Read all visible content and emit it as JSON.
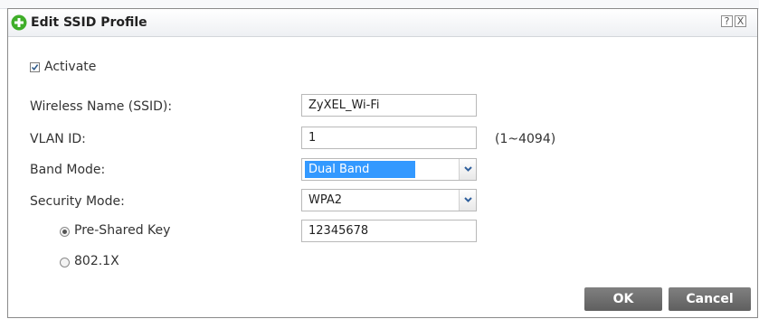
{
  "dialog": {
    "title": "Edit SSID Profile",
    "help_glyph": "?",
    "close_glyph": "X"
  },
  "form": {
    "activate": {
      "label": "Activate",
      "checked": true
    },
    "ssid": {
      "label": "Wireless Name (SSID):",
      "value": "ZyXEL_Wi-Fi"
    },
    "vlan": {
      "label": "VLAN ID:",
      "value": "1",
      "range_hint": "(1~4094)"
    },
    "band_mode": {
      "label": "Band Mode:",
      "selected": "Dual Band"
    },
    "security_mode": {
      "label": "Security Mode:",
      "selected": "WPA2"
    },
    "auth": {
      "psk_label": "Pre-Shared Key",
      "psk_selected": true,
      "psk_value": "12345678",
      "dot1x_label": "802.1X"
    }
  },
  "buttons": {
    "ok": "OK",
    "cancel": "Cancel"
  },
  "colors": {
    "accent_green": "#3fae29",
    "selection_blue": "#3399ff",
    "button_gray": "#6f6f6f"
  },
  "icons": [
    "add-icon",
    "help-icon",
    "close-icon",
    "chevron-down-icon",
    "check-icon"
  ]
}
